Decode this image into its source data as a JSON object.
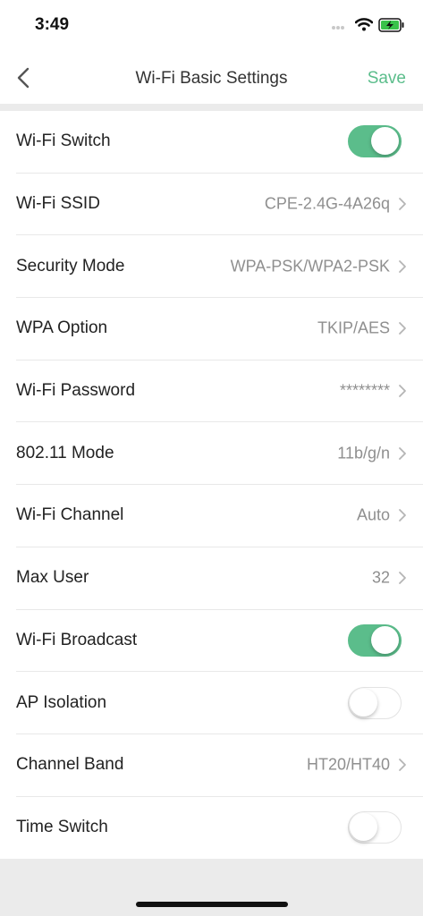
{
  "status_bar": {
    "time": "3:49"
  },
  "header": {
    "title": "Wi-Fi Basic Settings",
    "save_label": "Save"
  },
  "colors": {
    "accent": "#5bbd8b"
  },
  "settings": [
    {
      "label": "Wi-Fi Switch",
      "type": "toggle",
      "on": true
    },
    {
      "label": "Wi-Fi SSID",
      "type": "value",
      "value": "CPE-2.4G-4A26q"
    },
    {
      "label": "Security Mode",
      "type": "value",
      "value": "WPA-PSK/WPA2-PSK"
    },
    {
      "label": "WPA Option",
      "type": "value",
      "value": "TKIP/AES"
    },
    {
      "label": "Wi-Fi Password",
      "type": "value",
      "value": "********"
    },
    {
      "label": "802.11 Mode",
      "type": "value",
      "value": "11b/g/n"
    },
    {
      "label": "Wi-Fi Channel",
      "type": "value",
      "value": "Auto"
    },
    {
      "label": "Max User",
      "type": "value",
      "value": "32"
    },
    {
      "label": "Wi-Fi Broadcast",
      "type": "toggle",
      "on": true
    },
    {
      "label": "AP Isolation",
      "type": "toggle",
      "on": false
    },
    {
      "label": "Channel Band",
      "type": "value",
      "value": "HT20/HT40"
    },
    {
      "label": "Time Switch",
      "type": "toggle",
      "on": false
    }
  ]
}
